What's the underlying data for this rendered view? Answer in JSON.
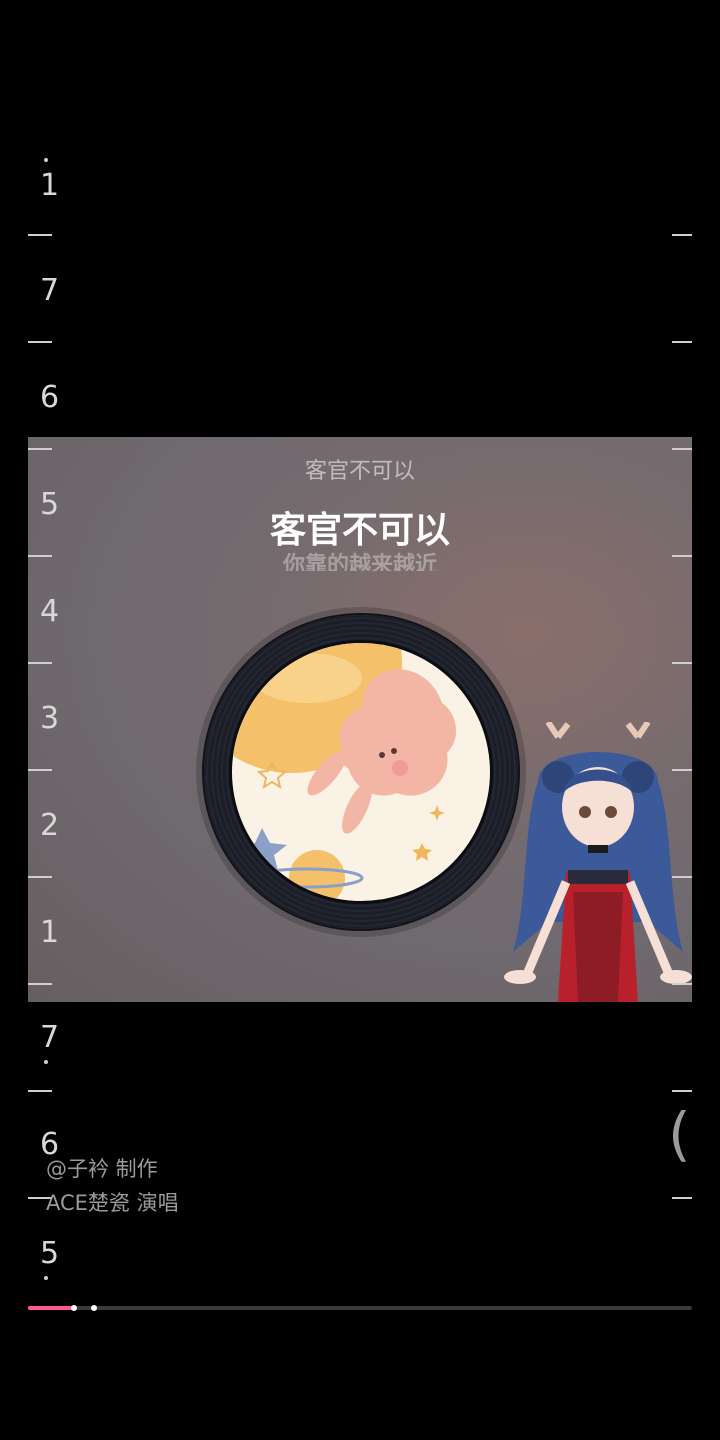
{
  "lyrics": {
    "previous": "客官不可以",
    "current": "客官不可以",
    "next": "你靠的越来越近"
  },
  "numbered_guide": {
    "labels": [
      "1",
      "7",
      "6",
      "5",
      "4",
      "3",
      "2",
      "1",
      "7",
      "6",
      "5"
    ]
  },
  "credits": {
    "producer": "@子衿 制作",
    "singer": "ACE楚瓷 演唱"
  },
  "side_glyph": "(",
  "progress": {
    "played_fraction": 0.07,
    "buffered_fraction": 0.1
  },
  "colors": {
    "background": "#000000",
    "accent": "#ff5a8c",
    "text": "#ffffff"
  },
  "icons": {
    "album_art": "bunny-planet-illustration",
    "avatar": "vtuber-deer-girl"
  }
}
